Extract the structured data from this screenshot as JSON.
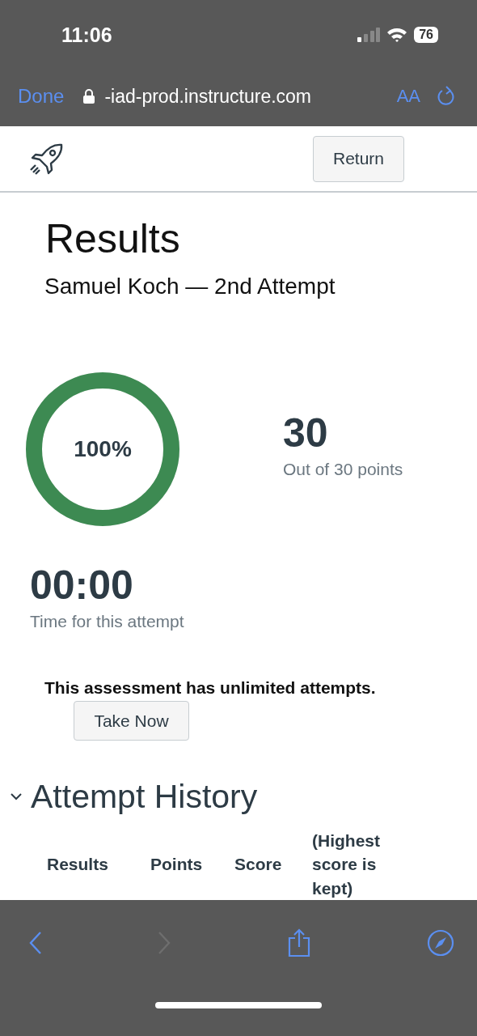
{
  "status_bar": {
    "time": "11:06",
    "battery": "76"
  },
  "browser_bar": {
    "done": "Done",
    "url": "-iad-prod.instructure.com",
    "text_size": "AA"
  },
  "header": {
    "return_button": "Return"
  },
  "title": "Results",
  "subtitle": "Samuel Koch — 2nd Attempt",
  "score": {
    "percent": "100%",
    "level": 1,
    "points": "30",
    "points_caption": "Out of 30 points"
  },
  "time": {
    "value": "00:00",
    "caption": "Time for this attempt"
  },
  "notice": "This assessment has unlimited attempts.",
  "take_now_button": "Take Now",
  "attempt_history": {
    "title": "Attempt History",
    "expanded": true,
    "columns": [
      "Results",
      "Points",
      "Score",
      "(Highest score is kept)"
    ]
  },
  "toolbar": {
    "back_disabled": false,
    "forward_disabled": true
  }
}
